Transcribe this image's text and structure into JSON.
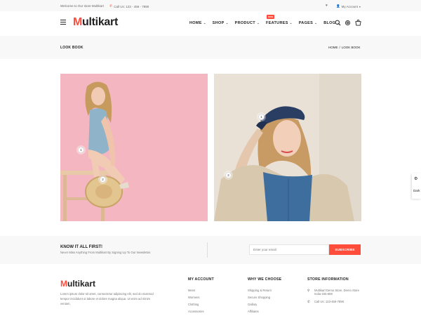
{
  "topbar": {
    "welcome": "Welcome to Our store Multikart",
    "call": "Call Us: 123 - 456 - 7890",
    "account": "My Account"
  },
  "header": {
    "logo_first": "M",
    "logo_rest": "ultikart",
    "nav": [
      {
        "label": "HOME"
      },
      {
        "label": "SHOP"
      },
      {
        "label": "PRODUCT"
      },
      {
        "label": "FEATURES",
        "badge": "new"
      },
      {
        "label": "PAGES"
      },
      {
        "label": "BLOG"
      }
    ]
  },
  "breadcrumb": {
    "title": "LOOK BOOK",
    "home": "HOME",
    "sep": "/",
    "current": "LOOK BOOK"
  },
  "lookbook": {
    "image1_pins": [
      "1",
      "2"
    ],
    "image2_pins": [
      "1",
      "2"
    ]
  },
  "sidetab": {
    "label": "Dark"
  },
  "newsletter": {
    "heading": "KNOW IT ALL FIRST!",
    "subtext": "Never Miss Anything From Multikart By Signing Up To Our Newsletter.",
    "placeholder": "Enter your email",
    "button": "SUBSCRIBE"
  },
  "footer": {
    "about": "Lorem ipsum dolor sit amet, consectetur adipiscing elit, sed do eiusmod tempor incididunt ut labore et dolore magna aliqua. Ut enim ad minim veniam,",
    "my_account": {
      "heading": "MY ACCOUNT",
      "links": [
        "Mens",
        "Womens",
        "Clothing",
        "Accessories"
      ]
    },
    "why_we_choose": {
      "heading": "WHY WE CHOOSE",
      "links": [
        "Shipping & Return",
        "Secure Shopping",
        "Gallary",
        "Affiliates"
      ]
    },
    "store_info": {
      "heading": "STORE INFORMATION",
      "address_line1": "Multikart Demo Store, Demo Store",
      "address_line2": "India-345-659",
      "phone": "Call Us: 123-456-7898"
    }
  },
  "colors": {
    "accent": "#ff4c3b",
    "band_bg": "#f8f8f8",
    "pink_bg": "#f4b7c1",
    "beige_bg": "#e9e1d6"
  }
}
